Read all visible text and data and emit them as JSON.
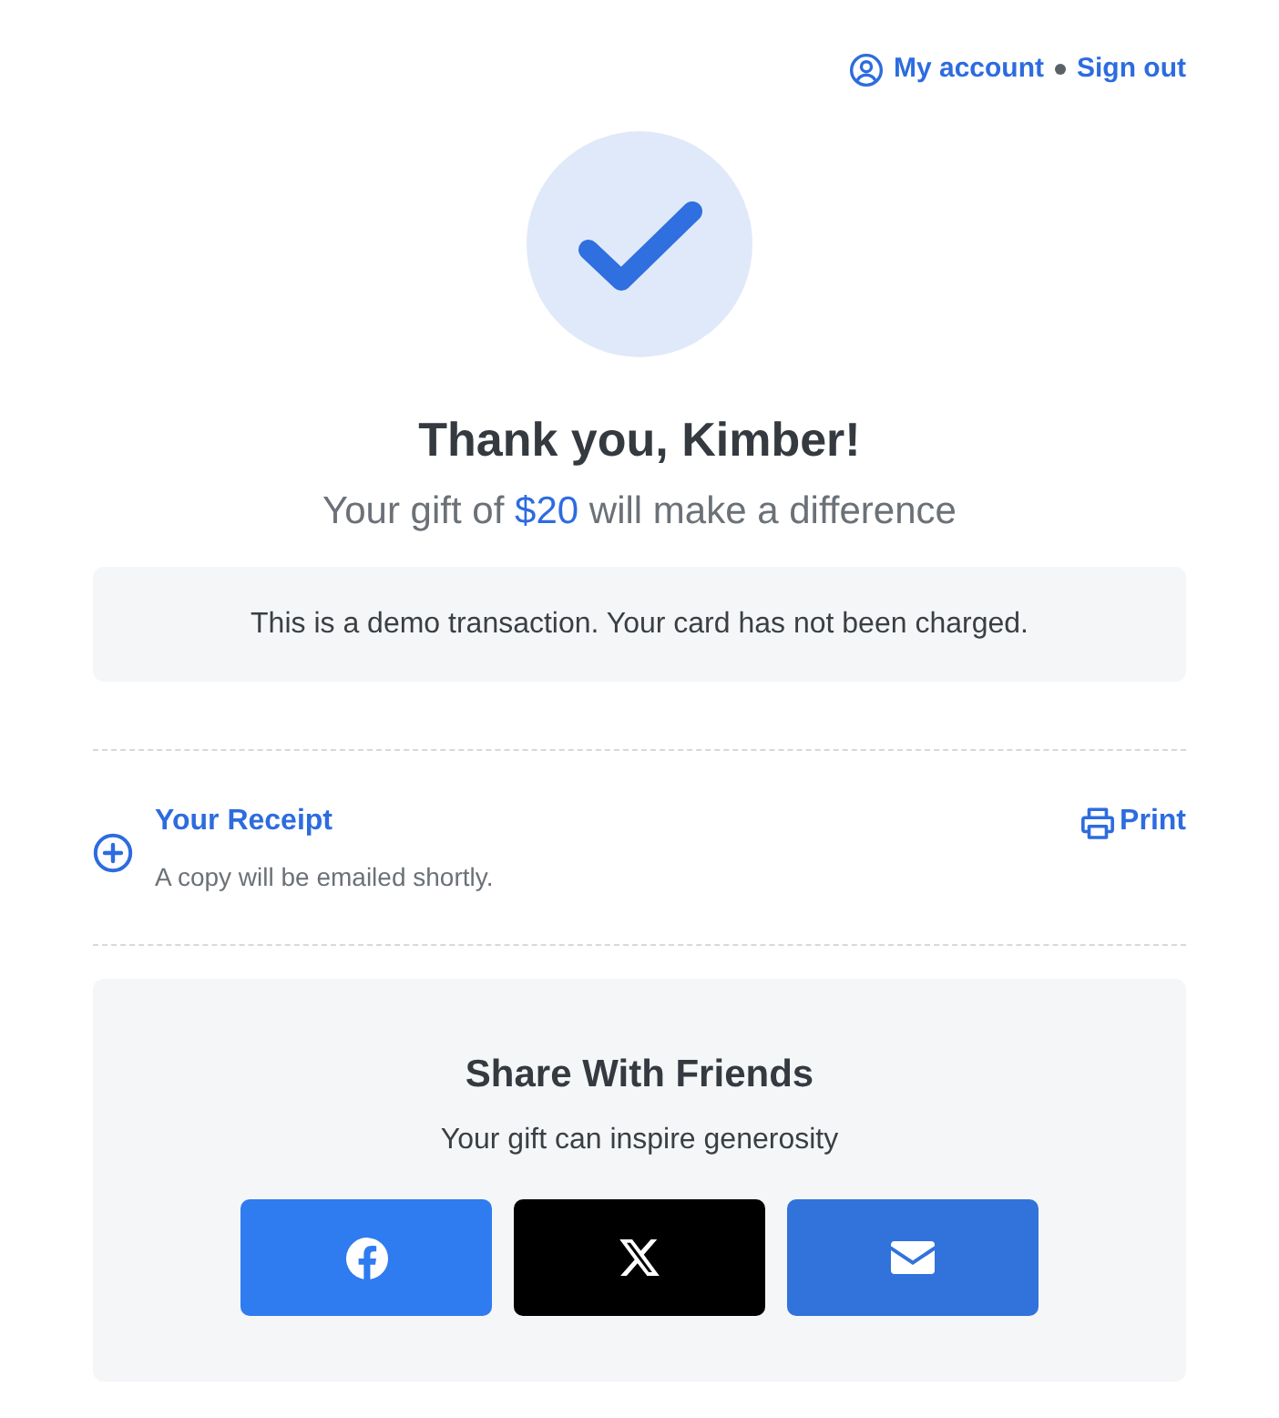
{
  "account_nav": {
    "my_account": "My account",
    "sign_out": "Sign out"
  },
  "confirmation": {
    "heading": "Thank you, Kimber!",
    "subtitle": {
      "before": "Your gift of",
      "amount": "$20",
      "after": "will make a difference"
    },
    "notice": "This is a demo transaction. Your card has not been charged."
  },
  "receipt": {
    "title": "Your Receipt",
    "note": "A copy will be emailed shortly.",
    "expanded": false,
    "print": "Print"
  },
  "share": {
    "title": "Share With Friends",
    "subtitle": "Your gift can inspire generosity",
    "buttons": [
      {
        "kind": "facebook"
      },
      {
        "kind": "x"
      },
      {
        "kind": "email"
      }
    ]
  }
}
